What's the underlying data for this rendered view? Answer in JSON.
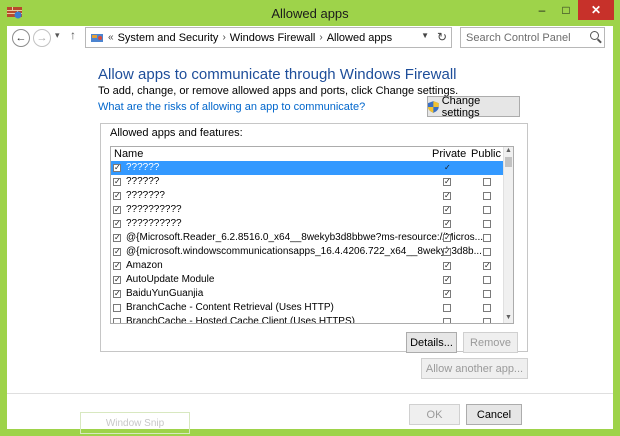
{
  "window": {
    "title": "Allowed apps",
    "minimize": "–",
    "maximize": "□",
    "close": "✕"
  },
  "nav": {
    "back": "←",
    "forward": "→",
    "recent": "▾",
    "up": "↑",
    "breadcrumb_prefix": "«",
    "breadcrumbs": [
      "System and Security",
      "Windows Firewall",
      "Allowed apps"
    ],
    "search_placeholder": "Search Control Panel"
  },
  "main": {
    "heading": "Allow apps to communicate through Windows Firewall",
    "subtext": "To add, change, or remove allowed apps and ports, click Change settings.",
    "risk_link": "What are the risks of allowing an app to communicate?",
    "change_settings": "Change settings",
    "group_label": "Allowed apps and features:",
    "columns": {
      "name": "Name",
      "private": "Private",
      "public": "Public"
    },
    "apps": [
      {
        "name": "??????",
        "enabled": true,
        "private": true,
        "public": false,
        "selected": true
      },
      {
        "name": "??????",
        "enabled": true,
        "private": true,
        "public": false
      },
      {
        "name": "???????",
        "enabled": true,
        "private": true,
        "public": false
      },
      {
        "name": "??????????",
        "enabled": true,
        "private": true,
        "public": false
      },
      {
        "name": "??????????",
        "enabled": true,
        "private": true,
        "public": false
      },
      {
        "name": "@{Microsoft.Reader_6.2.8516.0_x64__8wekyb3d8bbwe?ms-resource://Micros...",
        "enabled": true,
        "private": true,
        "public": false
      },
      {
        "name": "@{microsoft.windowscommunicationsapps_16.4.4206.722_x64__8wekyb3d8b...",
        "enabled": true,
        "private": true,
        "public": false
      },
      {
        "name": "Amazon",
        "enabled": true,
        "private": true,
        "public": true
      },
      {
        "name": "AutoUpdate Module",
        "enabled": true,
        "private": true,
        "public": false
      },
      {
        "name": "BaiduYunGuanjia",
        "enabled": true,
        "private": true,
        "public": false
      },
      {
        "name": "BranchCache - Content Retrieval (Uses HTTP)",
        "enabled": false,
        "private": false,
        "public": false
      },
      {
        "name": "BranchCache - Hosted Cache Client (Uses HTTPS)",
        "enabled": false,
        "private": false,
        "public": false
      }
    ],
    "details": "Details...",
    "remove": "Remove",
    "allow_another": "Allow another app...",
    "ok": "OK",
    "cancel": "Cancel"
  },
  "taskbar_ghost": "Window Snip"
}
